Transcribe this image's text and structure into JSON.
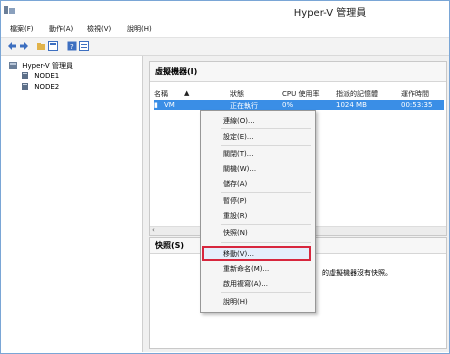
{
  "window": {
    "title": "Hyper-V 管理員"
  },
  "menubar": {
    "items": [
      "檔案(F)",
      "動作(A)",
      "檢視(V)",
      "說明(H)"
    ]
  },
  "toolbar": {
    "icons": [
      "back-icon",
      "forward-icon",
      "folder-icon",
      "console-icon",
      "help-icon",
      "properties-icon"
    ]
  },
  "tree": {
    "root": "Hyper-V 管理員",
    "nodes": [
      "NODE1",
      "NODE2"
    ]
  },
  "vm_section": {
    "title": "虛擬機器(I)",
    "columns": [
      "名稱",
      "狀態",
      "CPU 使用率",
      "指派的記憶體",
      "運作時間"
    ],
    "row": {
      "name": "VM",
      "status": "正在執行",
      "cpu": "0%",
      "memory": "1024 MB",
      "uptime": "00:53:35"
    }
  },
  "snapshot_section": {
    "title": "快照(S)",
    "message": "的虛擬機器沒有快照。"
  },
  "context_menu": {
    "items": [
      "連線(O)...",
      "設定(E)...",
      "關閉(T)...",
      "關機(W)...",
      "儲存(A)",
      "暫停(P)",
      "重設(R)",
      "快照(N)",
      "移動(V)...",
      "重新命名(M)...",
      "啟用複寫(A)...",
      "說明(H)"
    ],
    "highlighted": "移動(V)..."
  },
  "colors": {
    "selection": "#3a8ee6",
    "highlight_border": "#d7263d"
  }
}
